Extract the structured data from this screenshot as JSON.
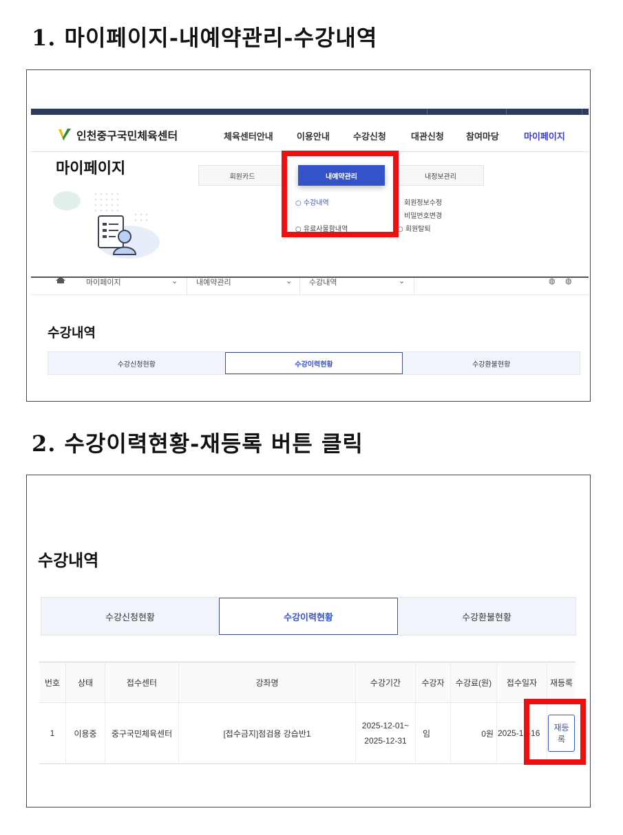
{
  "step1": {
    "title": "1. 마이페이지-내예약관리-수강내역"
  },
  "step2": {
    "title": "2. 수강이력현황-재등록 버튼 클릭"
  },
  "site": {
    "name": "인천중구국민체육센터",
    "gnb": [
      "체육센터안내",
      "이용안내",
      "수강신청",
      "대관신청",
      "참여마당",
      "마이페이지"
    ]
  },
  "mypage": {
    "title": "마이페이지",
    "subtabs": [
      "회원카드",
      "내예약관리",
      "내정보관리"
    ],
    "reservation_menu": [
      "수강내역",
      "유료사물함내역"
    ],
    "info_menu": [
      "회원정보수정",
      "비밀번호변경",
      "회원탈퇴"
    ]
  },
  "breadcrumb": [
    "마이페이지",
    "내예약관리",
    "수강내역"
  ],
  "section_title": "수강내역",
  "tabs": [
    "수강신청현황",
    "수강이력현황",
    "수강환불현황"
  ],
  "table": {
    "headers": [
      "번호",
      "상태",
      "접수센터",
      "강좌명",
      "수강기간",
      "수강자",
      "수강료(원)",
      "접수일자",
      "재등록"
    ],
    "row": {
      "no": "1",
      "status": "이용중",
      "center": "중구국민체육센터",
      "course": "[접수금지]점검용 강습반1",
      "period_start": "2025-12-01~",
      "period_end": "2025-12-31",
      "student": "임",
      "fee": "0원",
      "date": "2025-12-16",
      "button": "재등록"
    }
  },
  "colors": {
    "accent": "#3553c9",
    "highlight": "#ee1010",
    "topbar": "#2e3a5c"
  }
}
